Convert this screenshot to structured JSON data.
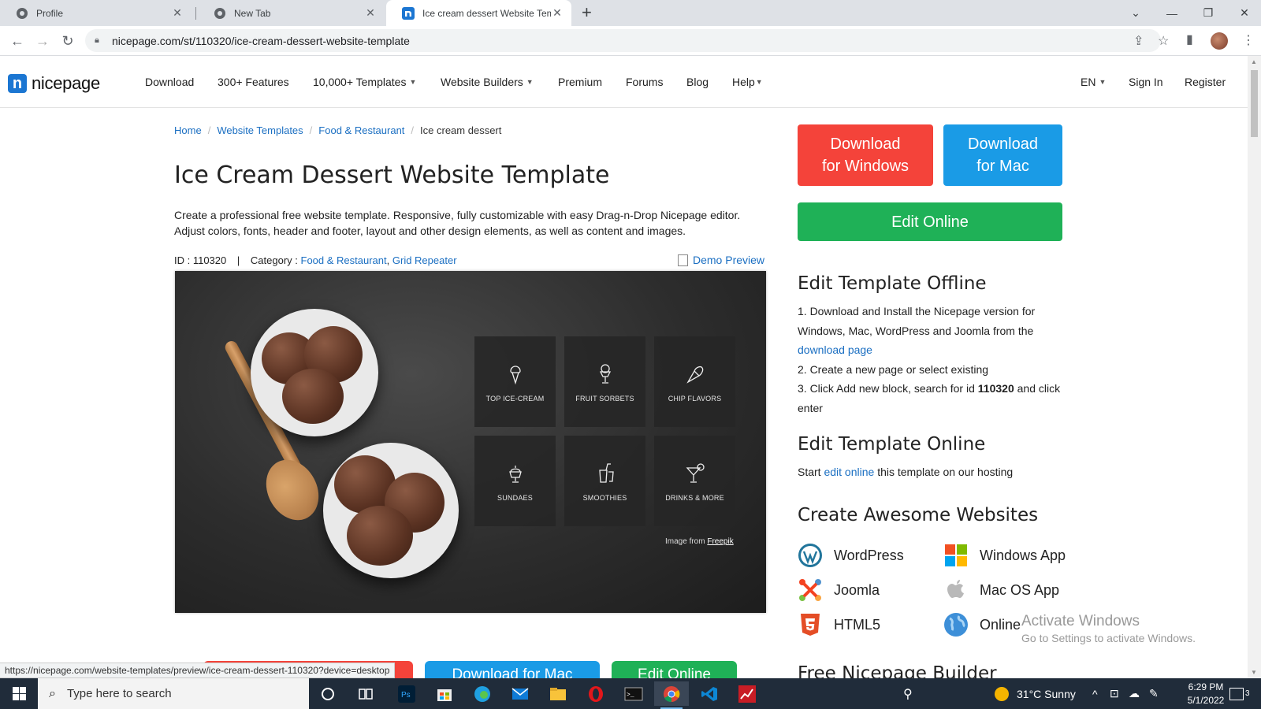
{
  "browser": {
    "tabs": [
      {
        "title": "Profile",
        "icon": "chrome-icon"
      },
      {
        "title": "New Tab",
        "icon": "chrome-icon"
      },
      {
        "title": "Ice cream dessert Website Templ",
        "icon": "nicepage-icon"
      }
    ],
    "url": "nicepage.com/st/110320/ice-cream-dessert-website-template",
    "status_url": "https://nicepage.com/website-templates/preview/ice-cream-dessert-110320?device=desktop"
  },
  "site": {
    "logo": "nicepage",
    "nav": [
      "Download",
      "300+ Features",
      "10,000+ Templates",
      "Website Builders",
      "Premium",
      "Forums",
      "Blog",
      "Help"
    ],
    "lang": "EN",
    "sign_in": "Sign In",
    "register": "Register"
  },
  "breadcrumb": [
    "Home",
    "Website Templates",
    "Food & Restaurant",
    "Ice cream dessert"
  ],
  "page": {
    "title": "Ice Cream Dessert Website Template",
    "description": "Create a professional free website template. Responsive, fully customizable with easy Drag-n-Drop Nicepage editor. Adjust colors, fonts, header and footer, layout and other design elements, as well as content and images.",
    "id_label": "ID : 110320",
    "category_label": "Category :",
    "categories": [
      "Food & Restaurant",
      "Grid Repeater"
    ],
    "demo_preview": "Demo Preview",
    "tiles": [
      "TOP ICE-CREAM",
      "FRUIT SORBETS",
      "CHIP FLAVORS",
      "SUNDAES",
      "SMOOTHIES",
      "DRINKS & MORE"
    ],
    "credit_prefix": "Image from",
    "credit_link": "Freepik"
  },
  "side": {
    "download_windows": [
      "Download",
      "for Windows"
    ],
    "download_mac": [
      "Download",
      "for Mac"
    ],
    "edit_online": "Edit Online",
    "offline_title": "Edit Template Offline",
    "offline_step1": "1. Download and Install the Nicepage version for Windows, Mac, WordPress and Joomla from the",
    "offline_link": "download page",
    "offline_step2": "2. Create a new page or select existing",
    "offline_step3_a": "3. Click Add new block, search for id",
    "offline_step3_id": "110320",
    "offline_step3_b": "and click enter",
    "online_title": "Edit Template Online",
    "online_a": "Start",
    "online_link": "edit online",
    "online_b": "this template on our hosting",
    "awesome_title": "Create Awesome Websites",
    "platforms": [
      "WordPress",
      "Windows App",
      "Joomla",
      "Mac OS App",
      "HTML5",
      "Online"
    ],
    "free_builder": "Free Nicepage Builder"
  },
  "bottom_buttons": [
    "Download for Mac",
    "Edit Online"
  ],
  "watermark": {
    "line1": "Activate Windows",
    "line2": "Go to Settings to activate Windows."
  },
  "taskbar": {
    "search_placeholder": "Type here to search",
    "weather": "31°C  Sunny",
    "time": "6:29 PM",
    "date": "5/1/2022",
    "notifications": "3"
  },
  "colors": {
    "red": "#f4433a",
    "blue": "#1a9be6",
    "green": "#1fb157",
    "link": "#1b6fc2"
  }
}
